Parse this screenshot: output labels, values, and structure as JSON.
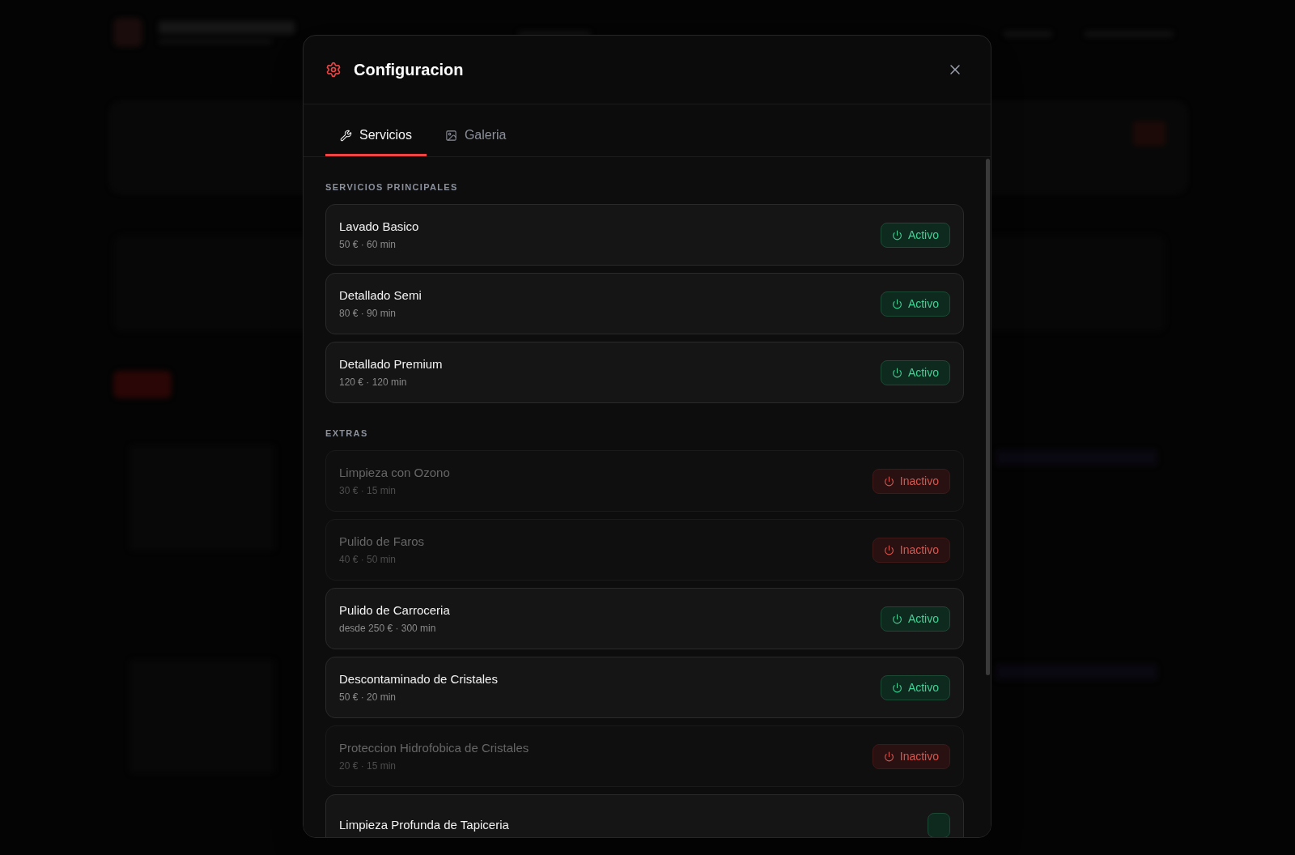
{
  "dialog": {
    "title": "Configuracion"
  },
  "tabs": [
    {
      "label": "Servicios",
      "selected": true
    },
    {
      "label": "Galeria",
      "selected": false
    }
  ],
  "sections": [
    {
      "heading": "SERVICIOS PRINCIPALES",
      "services": [
        {
          "name": "Lavado Basico",
          "detail": "50 € · 60 min",
          "active": true,
          "status": "Activo"
        },
        {
          "name": "Detallado Semi",
          "detail": "80 € · 90 min",
          "active": true,
          "status": "Activo"
        },
        {
          "name": "Detallado Premium",
          "detail": "120 € · 120 min",
          "active": true,
          "status": "Activo"
        }
      ]
    },
    {
      "heading": "EXTRAS",
      "services": [
        {
          "name": "Limpieza con Ozono",
          "detail": "30 € · 15 min",
          "active": false,
          "status": "Inactivo"
        },
        {
          "name": "Pulido de Faros",
          "detail": "40 € · 50 min",
          "active": false,
          "status": "Inactivo"
        },
        {
          "name": "Pulido de Carroceria",
          "detail": "desde 250 € · 300 min",
          "active": true,
          "status": "Activo"
        },
        {
          "name": "Descontaminado de Cristales",
          "detail": "50 € · 20 min",
          "active": true,
          "status": "Activo"
        },
        {
          "name": "Proteccion Hidrofobica de Cristales",
          "detail": "20 € · 15 min",
          "active": false,
          "status": "Inactivo"
        },
        {
          "name": "Limpieza Profunda de Tapiceria",
          "active": true
        }
      ]
    }
  ]
}
